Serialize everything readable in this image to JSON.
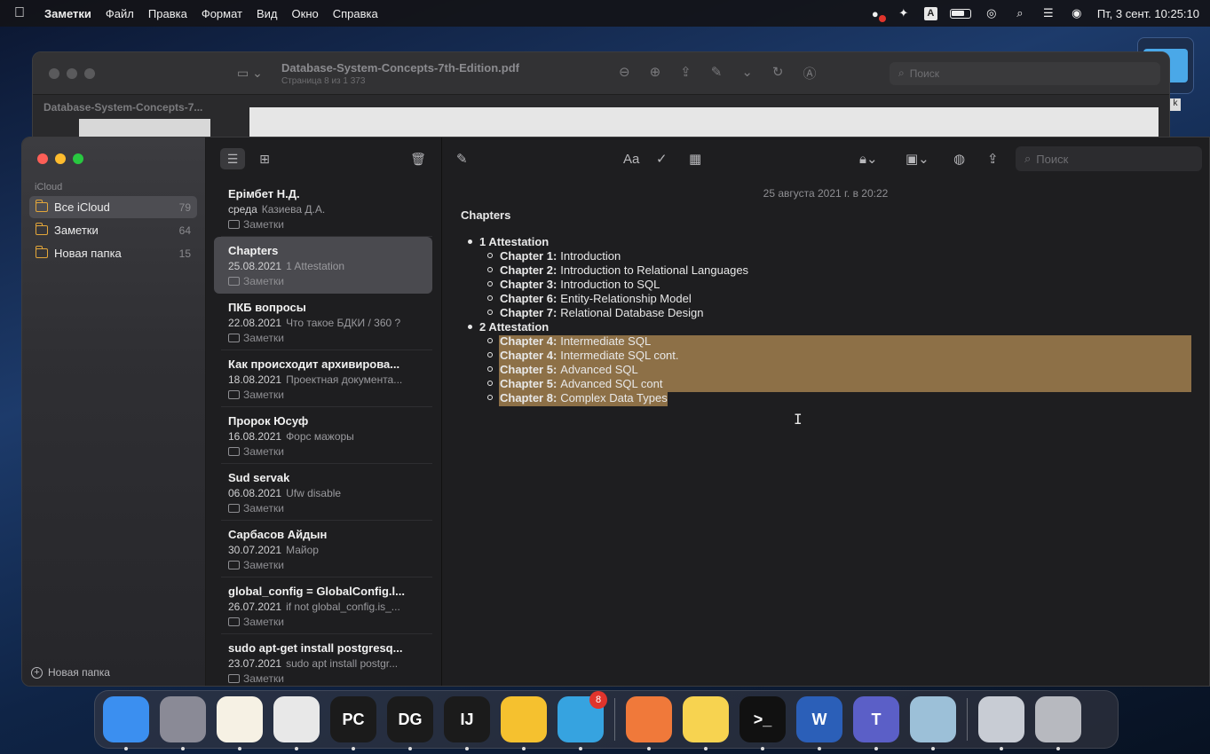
{
  "menubar": {
    "app_name": "Заметки",
    "items": [
      "Файл",
      "Правка",
      "Формат",
      "Вид",
      "Окно",
      "Справка"
    ],
    "input_badge": "A",
    "clock": "Пт, 3 сент.  10:25:10"
  },
  "pdf": {
    "title": "Database-System-Concepts-7th-Edition.pdf",
    "subtitle": "Страница 8 из 1 373",
    "thumb_label": "Database-System-Concepts-7...",
    "search_placeholder": "Поиск"
  },
  "desktop": {
    "k_label": "k"
  },
  "sidebar": {
    "section": "iCloud",
    "folders": [
      {
        "name": "Все iCloud",
        "count": "79"
      },
      {
        "name": "Заметки",
        "count": "64"
      },
      {
        "name": "Новая папка",
        "count": "15"
      }
    ],
    "new_folder": "Новая папка"
  },
  "notes": [
    {
      "title": "Ерімбет Н.Д.",
      "date": "среда",
      "preview": "Казиева Д.А.",
      "folder": "Заметки"
    },
    {
      "title": "Chapters",
      "date": "25.08.2021",
      "preview": "1 Attestation",
      "folder": "Заметки"
    },
    {
      "title": "ПКБ вопросы",
      "date": "22.08.2021",
      "preview": "Что такое БДКИ / 360 ?",
      "folder": "Заметки"
    },
    {
      "title": "Как происходит архивирова...",
      "date": "18.08.2021",
      "preview": "Проектная документа...",
      "folder": "Заметки"
    },
    {
      "title": "Пророк Юсуф",
      "date": "16.08.2021",
      "preview": "Форс мажоры",
      "folder": "Заметки"
    },
    {
      "title": "Sud servak",
      "date": "06.08.2021",
      "preview": "Ufw disable",
      "folder": "Заметки"
    },
    {
      "title": "Сарбасов Айдын",
      "date": "30.07.2021",
      "preview": "Майор",
      "folder": "Заметки"
    },
    {
      "title": "global_config = GlobalConfig.l...",
      "date": "26.07.2021",
      "preview": "if not global_config.is_...",
      "folder": "Заметки"
    },
    {
      "title": "sudo apt-get install postgresq...",
      "date": "23.07.2021",
      "preview": "sudo apt install postgr...",
      "folder": "Заметки"
    }
  ],
  "editor": {
    "format_label": "Aa",
    "search_placeholder": "Поиск",
    "date": "25 августа 2021 г. в 20:22",
    "heading": "Chapters",
    "groups": [
      {
        "label": "1 Attestation",
        "items": [
          {
            "chapter": "Chapter 1:",
            "title": "Introduction"
          },
          {
            "chapter": "Chapter 2:",
            "title": "Introduction to Relational Languages"
          },
          {
            "chapter": "Chapter 3:",
            "title": "Introduction to SQL"
          },
          {
            "chapter": "Chapter 6:",
            "title": "Entity-Relationship Model"
          },
          {
            "chapter": "Chapter 7:",
            "title": "Relational Database Design"
          }
        ]
      },
      {
        "label": "2 Attestation",
        "items": [
          {
            "chapter": "Chapter 4:",
            "title": "Intermediate SQL"
          },
          {
            "chapter": "Chapter 4:",
            "title": "Intermediate SQL cont."
          },
          {
            "chapter": "Chapter 5:",
            "title": "Advanced SQL"
          },
          {
            "chapter": "Chapter 5:",
            "title": "Advanced SQL cont"
          },
          {
            "chapter": "Chapter 8:",
            "title": "Complex Data Types"
          }
        ]
      }
    ],
    "highlight_color": "#8d7047"
  },
  "dock": {
    "apps": [
      {
        "name": "finder-app",
        "label": "",
        "color": "#3b8ff0"
      },
      {
        "name": "launchpad-app",
        "label": "",
        "color": "#8a8a96"
      },
      {
        "name": "pages-app",
        "label": "",
        "color": "#f6f1e4"
      },
      {
        "name": "chrome-app",
        "label": "",
        "color": "#e8e8e8"
      },
      {
        "name": "pycharm-app",
        "label": "PC",
        "color": "#1b1b1b"
      },
      {
        "name": "datagrip-app",
        "label": "DG",
        "color": "#1b1b1b"
      },
      {
        "name": "intellij-app",
        "label": "IJ",
        "color": "#1b1b1b"
      },
      {
        "name": "xcode-instruments-app",
        "label": "",
        "color": "#f5c12f"
      },
      {
        "name": "telegram-app",
        "label": "",
        "color": "#36a3e0",
        "badge": "8"
      },
      {
        "name": "vectornator-app",
        "label": "",
        "color": "#f0793a"
      },
      {
        "name": "notes-app",
        "label": "",
        "color": "#f7d350"
      },
      {
        "name": "terminal-app",
        "label": ">_",
        "color": "#111111"
      },
      {
        "name": "word-app",
        "label": "W",
        "color": "#2b5fb8"
      },
      {
        "name": "teams-app",
        "label": "T",
        "color": "#5b5fc7"
      },
      {
        "name": "preview-app",
        "label": "",
        "color": "#9cc0d8"
      },
      {
        "name": "document-app",
        "label": "",
        "color": "#c8ccd4"
      },
      {
        "name": "trash-app",
        "label": "",
        "color": "#b7b9bf"
      }
    ]
  }
}
